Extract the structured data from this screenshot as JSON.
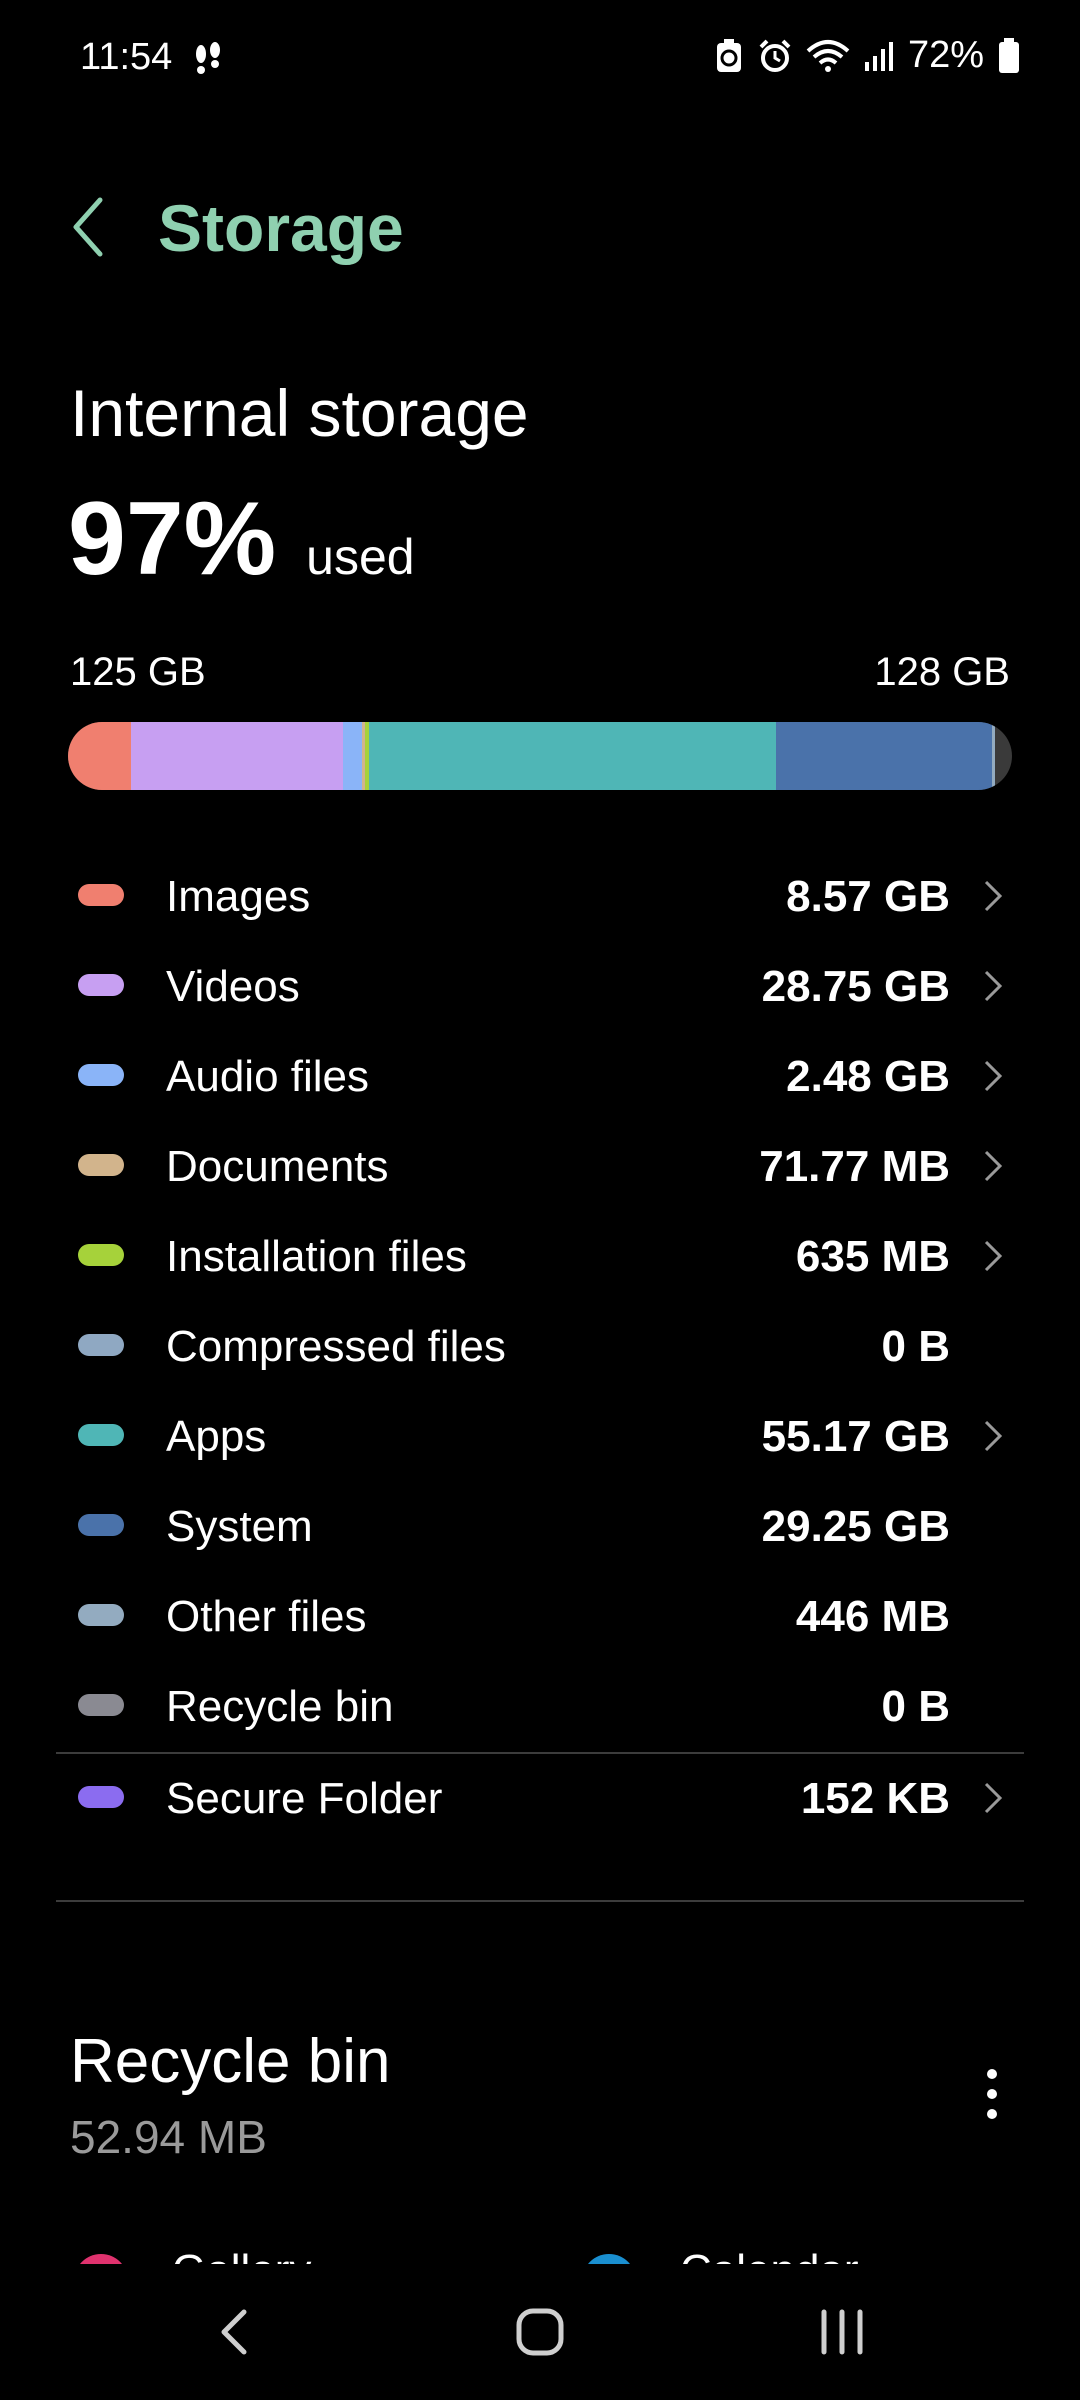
{
  "status_bar": {
    "time": "11:54",
    "battery": "72%"
  },
  "header": {
    "title": "Storage"
  },
  "summary": {
    "heading": "Internal storage",
    "percent": "97%",
    "used_label": "used",
    "used_size": "125 GB",
    "total_size": "128 GB",
    "used_fraction": 0.97
  },
  "categories": [
    {
      "name": "Images",
      "size": "8.57 GB",
      "color": "#f07f6f",
      "chevron": true
    },
    {
      "name": "Videos",
      "size": "28.75 GB",
      "color": "#c79ff2",
      "chevron": true
    },
    {
      "name": "Audio files",
      "size": "2.48 GB",
      "color": "#8ab4f8",
      "chevron": true
    },
    {
      "name": "Documents",
      "size": "71.77 MB",
      "color": "#d2b48c",
      "chevron": true
    },
    {
      "name": "Installation files",
      "size": "635 MB",
      "color": "#a6d23a",
      "chevron": true
    },
    {
      "name": "Compressed files",
      "size": "0 B",
      "color": "#8fa8c2",
      "chevron": false
    },
    {
      "name": "Apps",
      "size": "55.17 GB",
      "color": "#4fb6b6",
      "chevron": true
    },
    {
      "name": "System",
      "size": "29.25 GB",
      "color": "#4a72aa",
      "chevron": false
    },
    {
      "name": "Other files",
      "size": "446 MB",
      "color": "#93abc0",
      "chevron": false
    },
    {
      "name": "Recycle bin",
      "size": "0 B",
      "color": "#8a8a92",
      "chevron": false
    }
  ],
  "secure_folder": {
    "name": "Secure Folder",
    "size": "152 KB",
    "color": "#8b6cf0",
    "chevron": true
  },
  "recycle_section": {
    "title": "Recycle bin",
    "size": "52.94 MB",
    "items": [
      {
        "name": "Gallery",
        "color": "#e0326e"
      },
      {
        "name": "Calendar",
        "color": "#1a8fd0"
      }
    ]
  }
}
